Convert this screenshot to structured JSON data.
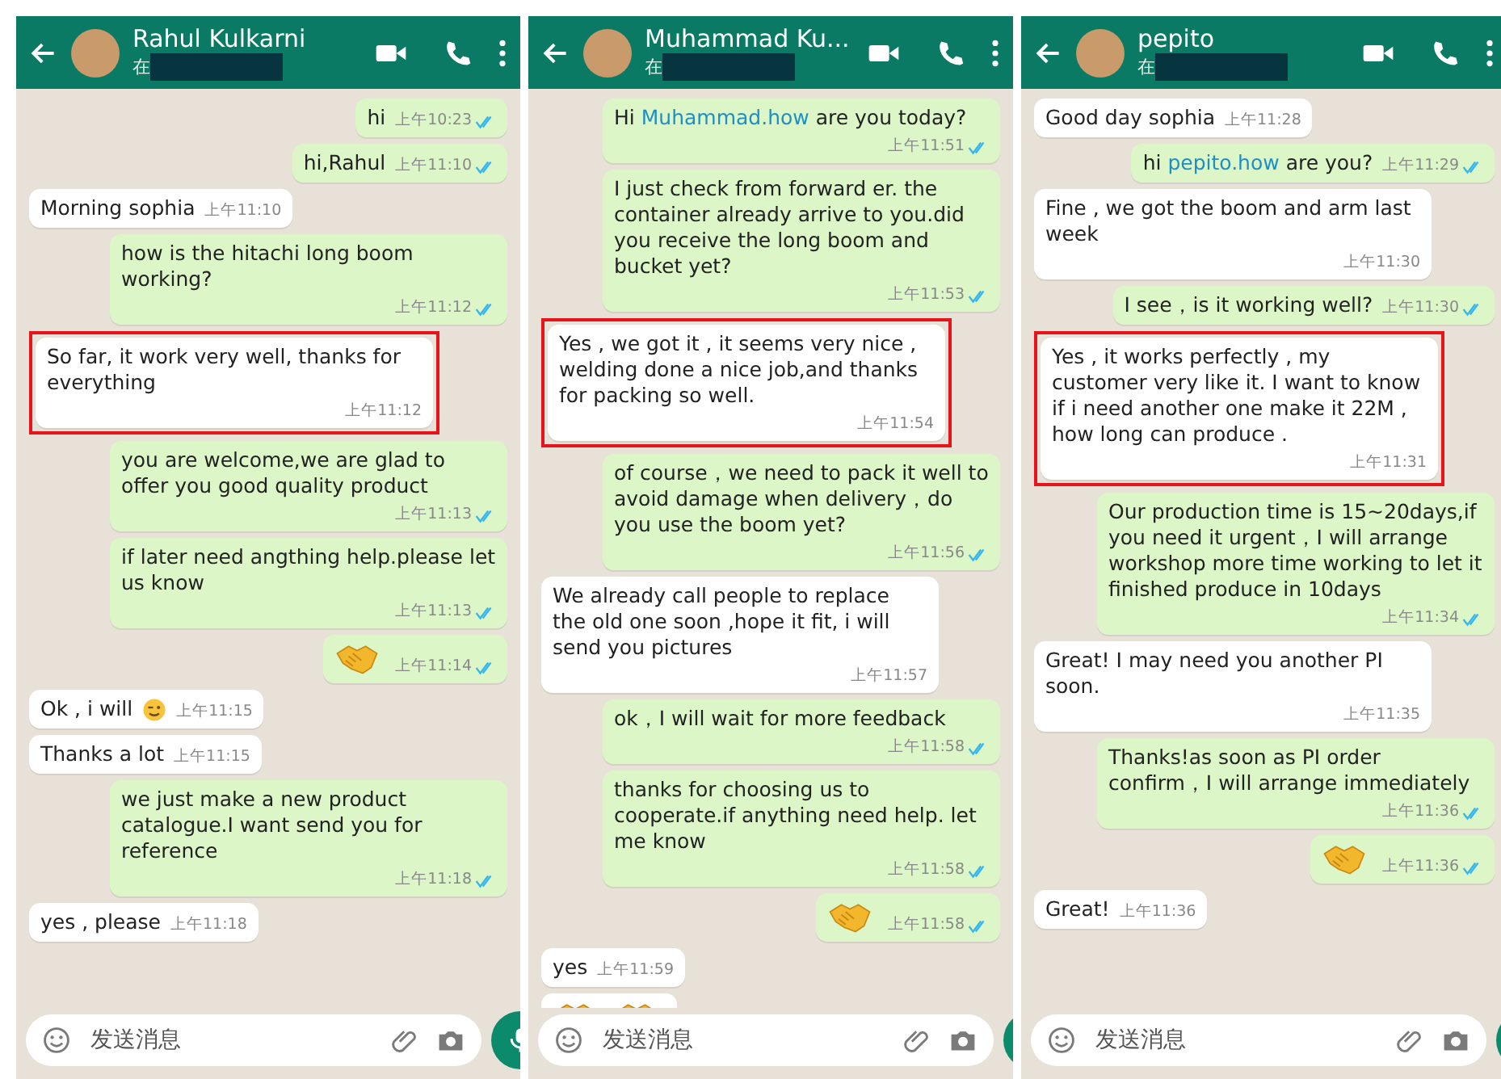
{
  "panels": [
    {
      "contact": {
        "name": "Rahul Kulkarni",
        "status": "在"
      },
      "input": {
        "placeholder": "发送消息"
      },
      "messages": [
        {
          "kind": "text",
          "outgoing": true,
          "text": "hi",
          "time": "上午10:23",
          "read": true
        },
        {
          "kind": "text",
          "outgoing": true,
          "text": "hi,Rahul",
          "time": "上午11:10",
          "read": true
        },
        {
          "kind": "text",
          "outgoing": false,
          "text": "Morning sophia",
          "time": "上午11:10"
        },
        {
          "kind": "text",
          "outgoing": true,
          "text": "how is the hitachi long boom working?",
          "time": "上午11:12",
          "read": true
        },
        {
          "kind": "text",
          "outgoing": false,
          "text": "So far, it work very well, thanks for everything",
          "time": "上午11:12",
          "highlighted": true
        },
        {
          "kind": "text",
          "outgoing": true,
          "text": "you are welcome,we are glad to offer you good quality product",
          "time": "上午11:13",
          "read": true
        },
        {
          "kind": "text",
          "outgoing": true,
          "text": "if later need angthing help.please let us know",
          "time": "上午11:13",
          "read": true
        },
        {
          "kind": "sticker",
          "outgoing": true,
          "time": "上午11:14",
          "read": true
        },
        {
          "kind": "wink",
          "outgoing": false,
          "text": "Ok , i will",
          "time": "上午11:15"
        },
        {
          "kind": "text",
          "outgoing": false,
          "text": "Thanks a lot",
          "time": "上午11:15"
        },
        {
          "kind": "text",
          "outgoing": true,
          "text": "we just make a new product catalogue.I want send you for reference",
          "time": "上午11:18",
          "read": true
        },
        {
          "kind": "text",
          "outgoing": false,
          "text": "yes , please",
          "time": "上午11:18"
        }
      ]
    },
    {
      "contact": {
        "name": "Muhammad Ku...",
        "status": "在"
      },
      "input": {
        "placeholder": "发送消息"
      },
      "messages": [
        {
          "kind": "link",
          "outgoing": true,
          "text": "Hi ",
          "link": "Muhammad.how",
          "after": " are you today?",
          "time": "上午11:51",
          "read": true
        },
        {
          "kind": "text",
          "outgoing": true,
          "text": "I just check from forward er. the container already arrive to you.did you receive the long boom and bucket yet?",
          "time": "上午11:53",
          "read": true
        },
        {
          "kind": "text",
          "outgoing": false,
          "text": "Yes , we got it , it seems very nice , welding done a nice job,and thanks for packing so well.",
          "time": "上午11:54",
          "highlighted": true
        },
        {
          "kind": "text",
          "outgoing": true,
          "text": "of course，we need to pack it well to avoid damage when delivery，do you use the boom yet?",
          "time": "上午11:56",
          "read": true
        },
        {
          "kind": "text",
          "outgoing": false,
          "text": "We already call people to replace the old one soon ,hope it fit, i will send you pictures",
          "time": "上午11:57"
        },
        {
          "kind": "text",
          "outgoing": true,
          "text": "ok，I will wait for more feedback",
          "time": "上午11:58",
          "read": true
        },
        {
          "kind": "text",
          "outgoing": true,
          "text": "thanks for choosing us to cooperate.if anything need help. let me know",
          "time": "上午11:58",
          "read": true
        },
        {
          "kind": "sticker",
          "outgoing": true,
          "time": "上午11:58",
          "read": true
        },
        {
          "kind": "text",
          "outgoing": false,
          "text": "yes",
          "time": "上午11:59"
        },
        {
          "kind": "stickers",
          "outgoing": false
        }
      ]
    },
    {
      "contact": {
        "name": "pepito",
        "status": "在"
      },
      "input": {
        "placeholder": "发送消息"
      },
      "messages": [
        {
          "kind": "text",
          "outgoing": false,
          "text": "Good day sophia",
          "time": "上午11:28"
        },
        {
          "kind": "link",
          "outgoing": true,
          "text": "hi ",
          "link": "pepito.how",
          "after": " are you?",
          "time": "上午11:29",
          "read": true
        },
        {
          "kind": "text",
          "outgoing": false,
          "text": "Fine , we got the boom and arm last week",
          "time": "上午11:30"
        },
        {
          "kind": "text",
          "outgoing": true,
          "text": "I see，is it working well?",
          "time": "上午11:30",
          "read": true
        },
        {
          "kind": "text",
          "outgoing": false,
          "text": "Yes , it works perfectly , my customer very like it. I want to know if i need another one make it 22M , how long can produce .",
          "time": "上午11:31",
          "highlighted": true
        },
        {
          "kind": "text",
          "outgoing": true,
          "text": "Our production time is 15~20days,if you need it urgent，I will arrange workshop more time working to let it finished produce in 10days",
          "time": "上午11:34",
          "read": true
        },
        {
          "kind": "text",
          "outgoing": false,
          "text": "Great! I may need you another PI soon.",
          "time": "上午11:35"
        },
        {
          "kind": "text",
          "outgoing": true,
          "text": "Thanks!as soon as PI order confirm，I will arrange immediately",
          "time": "上午11:36",
          "read": true
        },
        {
          "kind": "sticker",
          "outgoing": true,
          "time": "上午11:36",
          "read": true
        },
        {
          "kind": "text",
          "outgoing": false,
          "text": "Great!",
          "time": "上午11:36"
        }
      ]
    }
  ]
}
